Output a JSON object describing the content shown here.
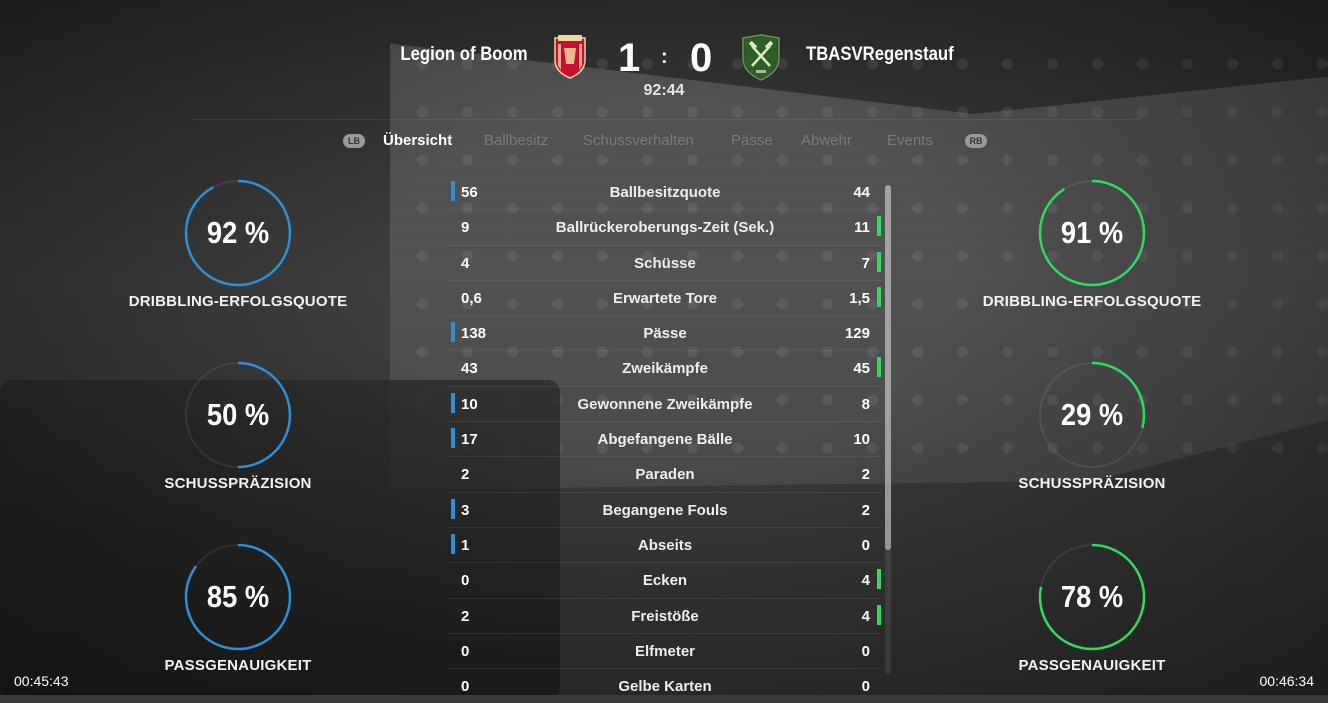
{
  "match": {
    "home_team": "Legion of Boom",
    "away_team": "TBASVRegenstauf",
    "home_score": "1",
    "separator": ":",
    "away_score": "0",
    "clock": "92:44",
    "home_crest_icon": "liverpool-crest-icon",
    "away_crest_icon": "hammers-shield-crest-icon"
  },
  "tabs": {
    "left_button": "LB",
    "right_button": "RB",
    "items": [
      {
        "label": "Übersicht",
        "active": true
      },
      {
        "label": "Ballbesitz",
        "active": false
      },
      {
        "label": "Schussverhalten",
        "active": false
      },
      {
        "label": "Pässe",
        "active": false
      },
      {
        "label": "Abwehr",
        "active": false
      },
      {
        "label": "Events",
        "active": false
      }
    ]
  },
  "home_rings": [
    {
      "value": "92 %",
      "label": "DRIBBLING-ERFOLGSQUOTE",
      "fraction": 0.92
    },
    {
      "value": "50 %",
      "label": "SCHUSSPRÄZISION",
      "fraction": 0.5
    },
    {
      "value": "85 %",
      "label": "PASSGENAUIGKEIT",
      "fraction": 0.85
    }
  ],
  "away_rings": [
    {
      "value": "91 %",
      "label": "DRIBBLING-ERFOLGSQUOTE",
      "fraction": 0.91
    },
    {
      "value": "29 %",
      "label": "SCHUSSPRÄZISION",
      "fraction": 0.29
    },
    {
      "value": "78 %",
      "label": "PASSGENAUIGKEIT",
      "fraction": 0.78
    }
  ],
  "stats": [
    {
      "name": "Ballbesitzquote",
      "home": "56",
      "away": "44",
      "leader": "home"
    },
    {
      "name": "Ballrückeroberungs-Zeit (Sek.)",
      "home": "9",
      "away": "11",
      "leader": "away"
    },
    {
      "name": "Schüsse",
      "home": "4",
      "away": "7",
      "leader": "away"
    },
    {
      "name": "Erwartete Tore",
      "home": "0,6",
      "away": "1,5",
      "leader": "away"
    },
    {
      "name": "Pässe",
      "home": "138",
      "away": "129",
      "leader": "home"
    },
    {
      "name": "Zweikämpfe",
      "home": "43",
      "away": "45",
      "leader": "away"
    },
    {
      "name": "Gewonnene Zweikämpfe",
      "home": "10",
      "away": "8",
      "leader": "home"
    },
    {
      "name": "Abgefangene Bälle",
      "home": "17",
      "away": "10",
      "leader": "home"
    },
    {
      "name": "Paraden",
      "home": "2",
      "away": "2",
      "leader": "none"
    },
    {
      "name": "Begangene Fouls",
      "home": "3",
      "away": "2",
      "leader": "home"
    },
    {
      "name": "Abseits",
      "home": "1",
      "away": "0",
      "leader": "home"
    },
    {
      "name": "Ecken",
      "home": "0",
      "away": "4",
      "leader": "away"
    },
    {
      "name": "Freistöße",
      "home": "2",
      "away": "4",
      "leader": "away"
    },
    {
      "name": "Elfmeter",
      "home": "0",
      "away": "0",
      "leader": "none"
    },
    {
      "name": "Gelbe Karten",
      "home": "0",
      "away": "0",
      "leader": "none"
    }
  ],
  "colors": {
    "home": "#2f8fd6",
    "away": "#2edb5f"
  },
  "timestamps": {
    "left": "00:45:43",
    "right": "00:46:34"
  }
}
